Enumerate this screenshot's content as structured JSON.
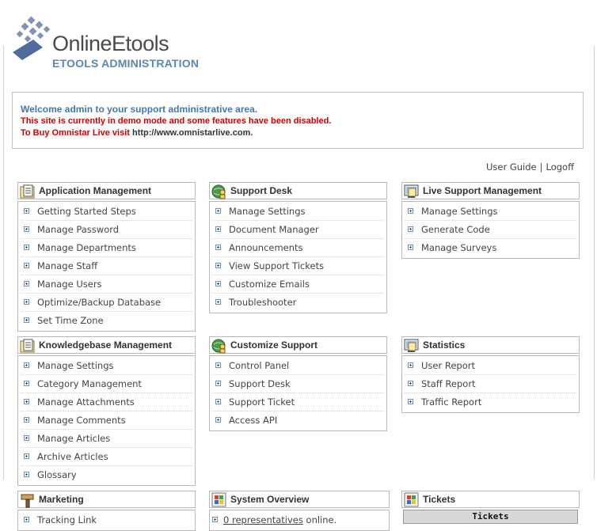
{
  "logo": {
    "name": "OnlineEtools",
    "subtitle": "ETOOLS ADMINISTRATION"
  },
  "welcome": {
    "line1": "Welcome admin to your support administrative area.",
    "line2": "This site is currently in demo mode and some features have been disabled.",
    "line3_prefix": "To Buy Omnistar Live visit ",
    "line3_url": "http://www.omnistarlive.com",
    "line3_suffix": "."
  },
  "toplinks": {
    "user_guide": "User Guide",
    "separator": "|",
    "logoff": "Logoff"
  },
  "panels": {
    "app_mgmt": {
      "title": "Application Management",
      "icon": "notepad-icon",
      "items": [
        "Getting Started Steps",
        "Manage Password",
        "Manage Departments",
        "Manage Staff",
        "Manage Users",
        "Optimize/Backup Database",
        "Set Time Zone"
      ]
    },
    "support_desk": {
      "title": "Support Desk",
      "icon": "globe-person-icon",
      "items": [
        "Manage Settings",
        "Document Manager",
        "Announcements",
        "View Support Tickets",
        "Customize Emails",
        "Troubleshooter"
      ]
    },
    "live_support": {
      "title": "Live Support Management",
      "icon": "monitor-notepad-icon",
      "items": [
        "Manage Settings",
        "Generate Code",
        "Manage Surveys"
      ]
    },
    "kb_mgmt": {
      "title": "Knowledgebase Management",
      "icon": "notepad-icon",
      "items": [
        "Manage Settings",
        "Category Management",
        "Manage Attachments",
        "Manage Comments",
        "Manage Articles",
        "Archive Articles",
        "Glossary"
      ]
    },
    "customize": {
      "title": "Customize Support",
      "icon": "globe-person-icon",
      "items": [
        "Control Panel",
        "Support Desk",
        "Support Ticket",
        "Access API"
      ]
    },
    "statistics": {
      "title": "Statistics",
      "icon": "monitor-notepad-icon",
      "items": [
        "User Report",
        "Staff Report",
        "Traffic Report"
      ]
    },
    "marketing": {
      "title": "Marketing",
      "icon": "hammer-icon",
      "items": [
        "Tracking Link"
      ]
    },
    "system_overview": {
      "title": "System Overview",
      "icon": "windows-icon",
      "online_count": "0 representatives",
      "online_suffix": " online."
    },
    "tickets": {
      "title": "Tickets",
      "icon": "windows-icon",
      "bar_label": "Tickets"
    }
  }
}
